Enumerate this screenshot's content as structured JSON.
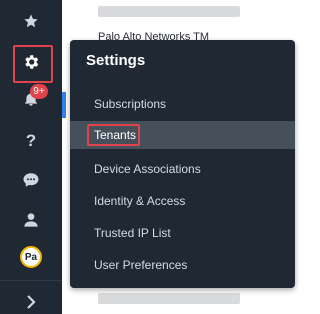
{
  "background": {
    "partial_text": "Palo Alto Networks TM"
  },
  "rail": {
    "items": [
      {
        "name": "favorites",
        "icon": "star-icon"
      },
      {
        "name": "settings",
        "icon": "gear-icon"
      },
      {
        "name": "notifications",
        "icon": "bell-icon",
        "badge": "9+"
      },
      {
        "name": "help",
        "icon": "question-icon"
      },
      {
        "name": "chat",
        "icon": "chat-bubble-icon"
      },
      {
        "name": "user",
        "icon": "user-icon"
      },
      {
        "name": "account",
        "avatar_initials": "Pa"
      },
      {
        "name": "expand",
        "icon": "chevron-right-icon"
      }
    ]
  },
  "menu": {
    "title": "Settings",
    "items": [
      {
        "label": "Subscriptions"
      },
      {
        "label": "Tenants",
        "selected": true
      },
      {
        "label": "Device Associations"
      },
      {
        "label": "Identity & Access"
      },
      {
        "label": "Trusted IP List"
      },
      {
        "label": "User Preferences"
      }
    ]
  },
  "colors": {
    "rail_bg": "#1f2833",
    "menu_bg": "#1f2833",
    "selected_bg": "#46505b",
    "highlight": "#e0434a",
    "badge": "#e0434a",
    "avatar_ring": "#f5b400"
  }
}
